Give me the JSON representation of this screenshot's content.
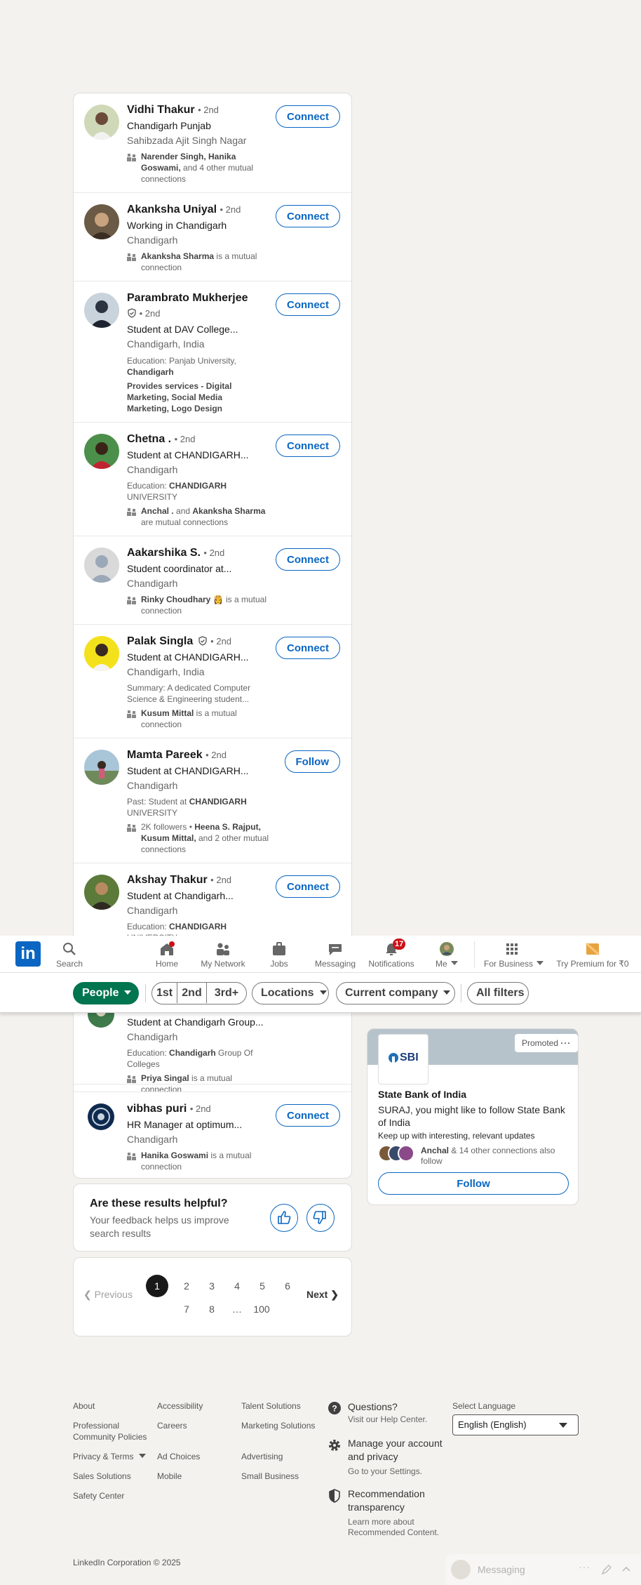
{
  "people": [
    {
      "name": "Vidhi Thakur",
      "degree": "• 2nd",
      "headline": "Chandigarh Punjab",
      "location": "Sahibzada Ajit Singh Nagar",
      "mutual_bold": "Narender Singh, Hanika Goswami,",
      "mutual_rest": " and 4 other mutual connections",
      "action": "Connect"
    },
    {
      "name": "Akanksha Uniyal",
      "degree": "• 2nd",
      "headline": "Working in Chandigarh",
      "location": "Chandigarh",
      "mutual_bold": "Akanksha Sharma",
      "mutual_rest": " is a mutual connection",
      "action": "Connect"
    },
    {
      "name": "Parambrato Mukherjee",
      "degree": "• 2nd",
      "headline": "Student at DAV College...",
      "location": "Chandigarh, India",
      "education_prefix": "Education: Panjab University, ",
      "education_bold": "Chandigarh",
      "services": "Provides services - Digital Marketing, Social Media Marketing, Logo Design",
      "action": "Connect"
    },
    {
      "name": "Chetna .",
      "degree": "• 2nd",
      "headline": "Student at CHANDIGARH...",
      "location": "Chandigarh",
      "education_prefix": "Education: ",
      "education_bold": "CHANDIGARH",
      "education_rest": " UNIVERSITY",
      "mutual_bold": "Anchal .",
      "mutual_mid": " and ",
      "mutual_bold2": "Akanksha Sharma",
      "mutual_rest": " are mutual connections",
      "action": "Connect"
    },
    {
      "name": "Aakarshika S.",
      "degree": "• 2nd",
      "headline": "Student coordinator at...",
      "location": "Chandigarh",
      "mutual_bold": "Rinky Choudhary",
      "mutual_emoji": "👸",
      "mutual_rest": " is a mutual connection",
      "action": "Connect"
    },
    {
      "name": "Palak Singla",
      "degree": "• 2nd",
      "headline": "Student at CHANDIGARH...",
      "location": "Chandigarh, India",
      "summary": "Summary: A dedicated Computer Science & Engineering student...",
      "mutual_bold": "Kusum Mittal",
      "mutual_rest": " is a mutual connection",
      "action": "Connect"
    },
    {
      "name": "Mamta Pareek",
      "degree": "• 2nd",
      "headline": "Student at CHANDIGARH...",
      "location": "Chandigarh",
      "past_prefix": "Past: Student at ",
      "past_bold": "CHANDIGARH",
      "past_rest": " UNIVERSITY",
      "followers": "2K followers • ",
      "mutual_bold": "Heena S. Rajput, Kusum Mittal,",
      "mutual_rest": " and 2 other mutual connections",
      "action": "Follow"
    },
    {
      "name": "Akshay Thakur",
      "degree": "• 2nd",
      "headline": "Student at Chandigarh...",
      "location": "Chandigarh",
      "education_prefix": "Education: ",
      "education_bold": "CHANDIGARH",
      "education_rest": " UNIVERSITY",
      "action": "Connect"
    },
    {
      "name": "",
      "headline": "Student at Chandigarh Group...",
      "location": "Chandigarh",
      "education_prefix": "Education: ",
      "education_bold": "Chandigarh",
      "education_rest": " Group Of Colleges",
      "mutual_bold": "Priya Singal",
      "mutual_rest": " is a mutual connection"
    },
    {
      "name": "vibhas puri",
      "degree": "• 2nd",
      "headline": "HR Manager at optimum...",
      "location": "Chandigarh",
      "mutual_bold": "Hanika Goswami",
      "mutual_rest": " is a mutual connection",
      "action": "Connect"
    }
  ],
  "nav": {
    "search": "Search",
    "home": "Home",
    "network": "My Network",
    "jobs": "Jobs",
    "messaging": "Messaging",
    "notifications": "Notifications",
    "notif_count": "17",
    "me": "Me",
    "business": "For Business",
    "premium": "Try Premium for ₹0"
  },
  "filters": {
    "people": "People",
    "first": "1st",
    "second": "2nd",
    "third": "3rd+",
    "locations": "Locations",
    "company": "Current company",
    "all": "All filters"
  },
  "ad": {
    "promoted": "Promoted",
    "logo": "SBI",
    "company": "State Bank of India",
    "message": "SURAJ, you might like to follow State Bank of India",
    "tagline": "Keep up with interesting, relevant updates",
    "conn_bold": "Anchal",
    "conn_rest": " & 14 other connections also follow",
    "follow": "Follow"
  },
  "feedback": {
    "title": "Are these results helpful?",
    "sub": "Your feedback helps us improve search results"
  },
  "pagination": {
    "previous": "Previous",
    "next": "Next",
    "row1": [
      "1",
      "2",
      "3",
      "4",
      "5",
      "6"
    ],
    "row2": [
      "7",
      "8",
      "…",
      "100"
    ],
    "current": "1"
  },
  "footer": {
    "col1": [
      "About",
      "Professional Community Policies",
      "Privacy & Terms",
      "Sales Solutions",
      "Safety Center"
    ],
    "col2": [
      "Accessibility",
      "Careers",
      "Ad Choices",
      "Mobile"
    ],
    "col3": [
      "Talent Solutions",
      "Marketing Solutions",
      "Advertising",
      "Small Business"
    ],
    "help_title": "Questions?",
    "help_sub": "Visit our Help Center.",
    "account_title": "Manage your account and privacy",
    "account_sub": "Go to your Settings.",
    "rec_title": "Recommendation transparency",
    "rec_sub": "Learn more about Recommended Content.",
    "lang_label": "Select Language",
    "lang_value": "English (English)",
    "copyright": "LinkedIn Corporation © 2025"
  },
  "messaging_bar": {
    "label": "Messaging"
  },
  "colors": {
    "brand": "#0a66c2",
    "green": "#01754f",
    "notif": "#cc1016"
  }
}
